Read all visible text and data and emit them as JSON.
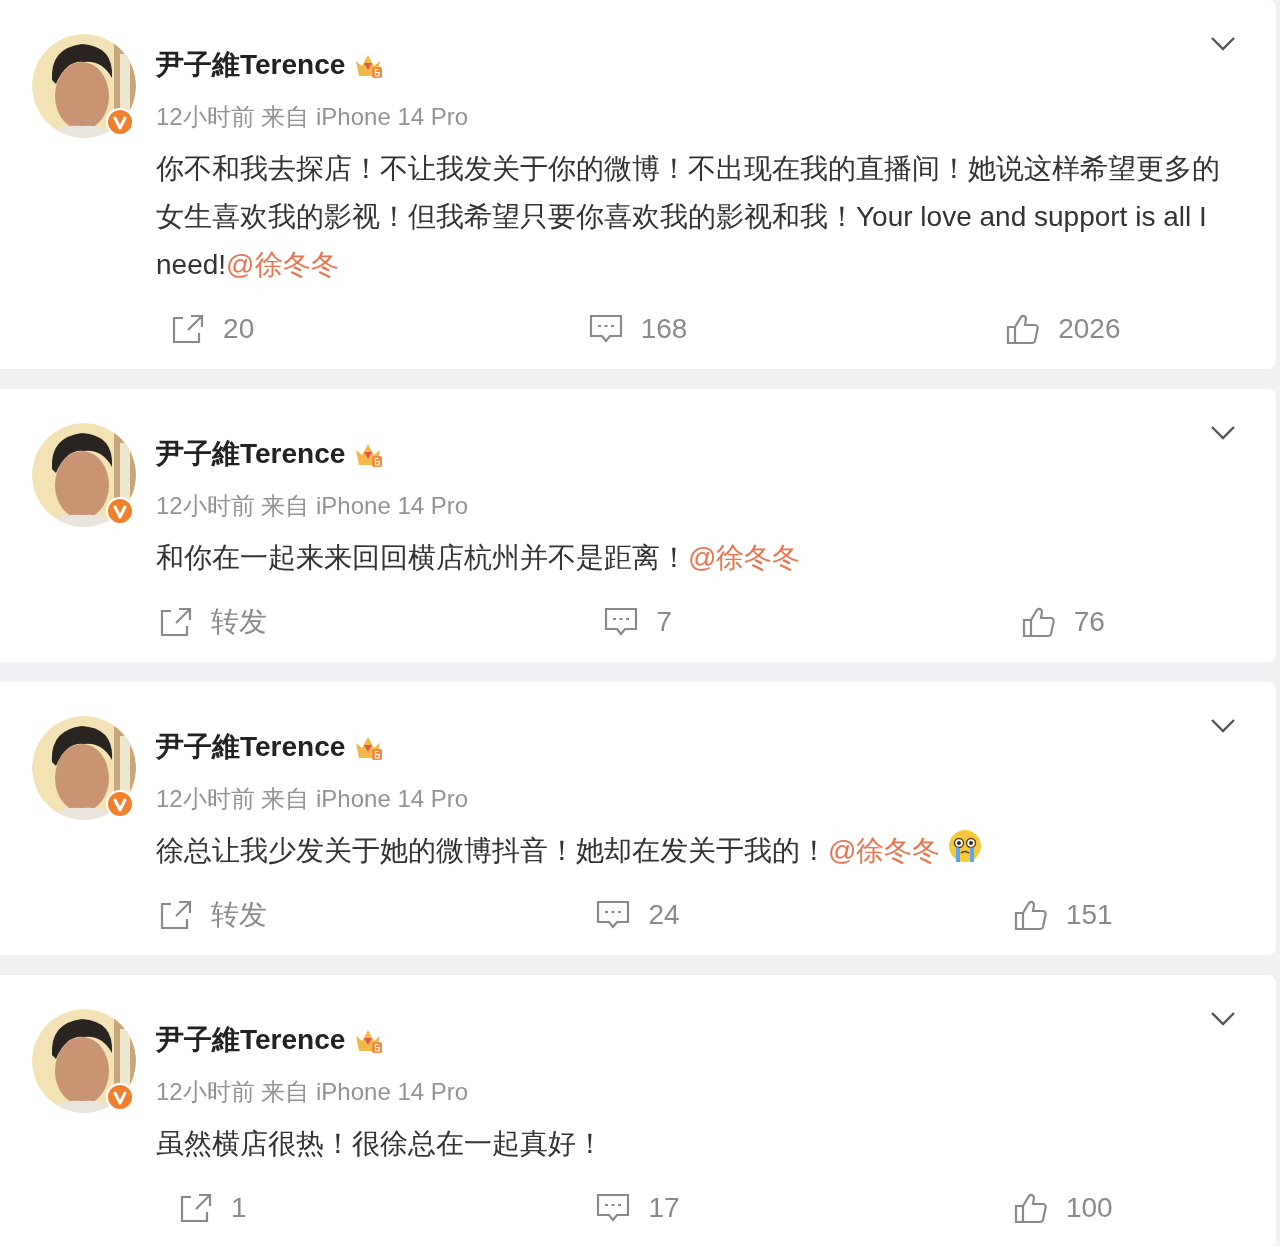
{
  "posts": [
    {
      "author": "尹子維Terence",
      "meta": "12小时前 来自 iPhone 14 Pro",
      "text": "你不和我去探店！不让我发关于你的微博！不出现在我的直播间！她说这样希望更多的女生喜欢我的影视！但我希望只要你喜欢我的影视和我！Your love and support is all I need!",
      "mention": "@徐冬冬",
      "crying_emoji": false,
      "repost": "20",
      "comments": "168",
      "likes": "2026"
    },
    {
      "author": "尹子維Terence",
      "meta": "12小时前 来自 iPhone 14 Pro",
      "text": "和你在一起来来回回横店杭州并不是距离！",
      "mention": "@徐冬冬",
      "crying_emoji": false,
      "repost": "转发",
      "comments": "7",
      "likes": "76"
    },
    {
      "author": "尹子維Terence",
      "meta": "12小时前 来自 iPhone 14 Pro",
      "text": "徐总让我少发关于她的微博抖音！她却在发关于我的！",
      "mention": "@徐冬冬",
      "crying_emoji": true,
      "repost": "转发",
      "comments": "24",
      "likes": "151"
    },
    {
      "author": "尹子維Terence",
      "meta": "12小时前 来自 iPhone 14 Pro",
      "text": "虽然横店很热！很徐总在一起真好！",
      "crying_emoji": false,
      "repost": "1",
      "comments": "17",
      "likes": "100"
    }
  ]
}
